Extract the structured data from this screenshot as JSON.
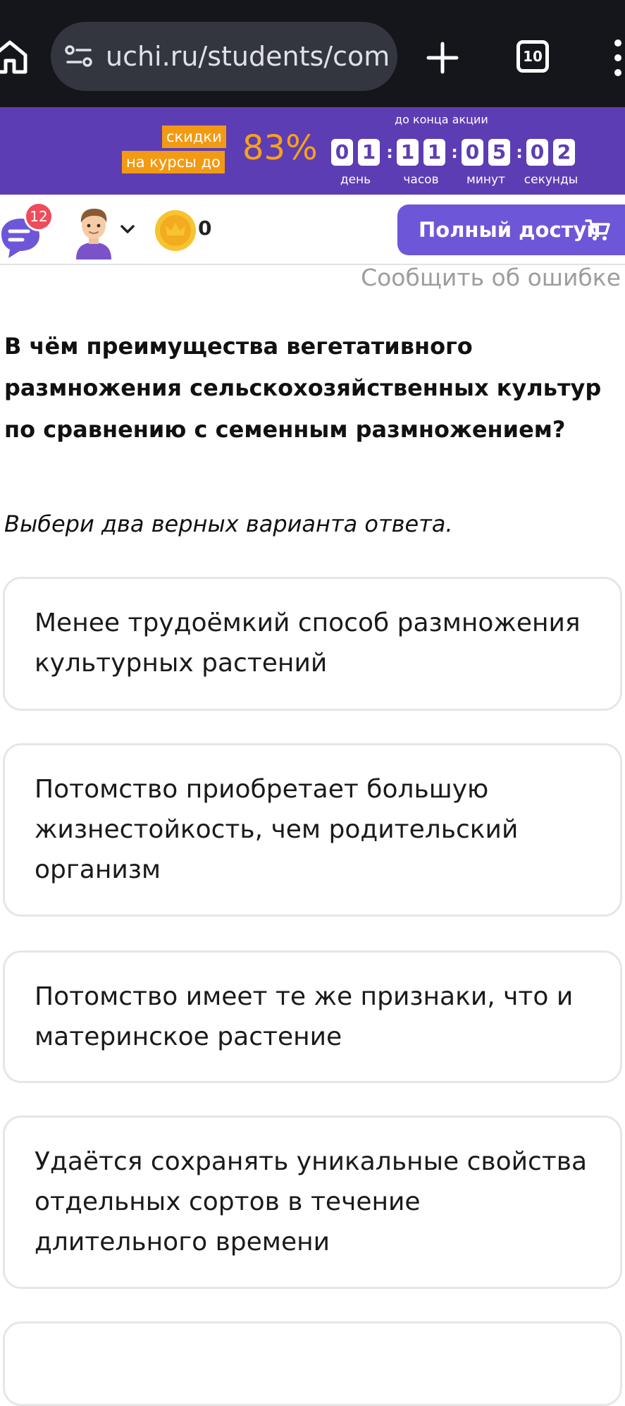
{
  "browser": {
    "url": "uchi.ru/students/comp",
    "tabs_count": "10",
    "icons": [
      "home-icon",
      "site-settings-icon",
      "plus-icon",
      "tabs-icon",
      "more-menu-icon"
    ]
  },
  "promo": {
    "tag_line1": "скидки",
    "tag_line2": "на курсы до",
    "percent": "83%",
    "until_label": "до конца акции",
    "countdown": {
      "days": [
        "0",
        "1"
      ],
      "hours": [
        "1",
        "1"
      ],
      "minutes": [
        "0",
        "5"
      ],
      "seconds": [
        "0",
        "2"
      ]
    },
    "units": {
      "days": "день",
      "hours": "часов",
      "minutes": "минут",
      "seconds": "секунды"
    },
    "colors": {
      "background": "#5d3db4",
      "accent": "#f39a13"
    }
  },
  "header": {
    "notifications_count": "12",
    "coins": "0",
    "full_access_label": "Полный доступ",
    "button_color": "#6e56d8"
  },
  "report_error_label": "Сообщить об ошибке",
  "question": "В чём преимущества вегетативного размножения сельскохозяйственных культур по сравнению с семенным размножением?",
  "instruction": "Выбери два верных варианта ответа.",
  "answers": [
    "Менее трудоёмкий способ размножения культурных растений",
    "Потомство приобретает большую жизнестойкость, чем родительский организм",
    "Потомство имеет те же признаки, что и материнское растение",
    "Удаётся сохранять уникальные свойства отдельных сортов в течение длительного времени"
  ]
}
